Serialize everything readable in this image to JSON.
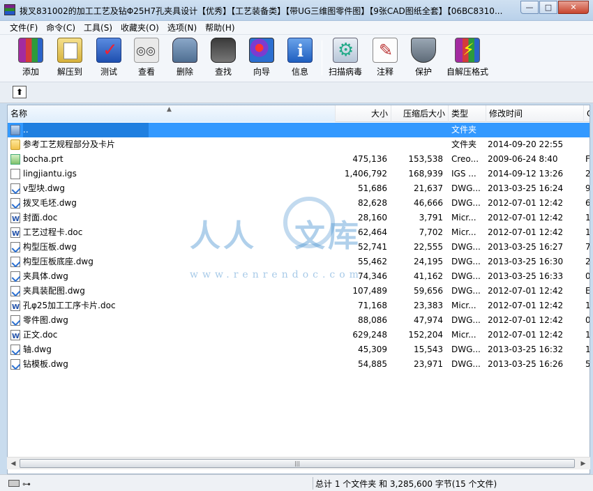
{
  "window": {
    "title": "拨叉831002的加工工艺及钻Φ25H7孔夹具设计【优秀】【工艺装备类】【带UG三维图零件图】【9张CAD图纸全套】【06BC8310...",
    "minimize": "—",
    "maximize": "□",
    "close": "✕"
  },
  "menu": [
    "文件(F)",
    "命令(C)",
    "工具(S)",
    "收藏夹(O)",
    "选项(N)",
    "帮助(H)"
  ],
  "toolbar": {
    "buttons": [
      {
        "label": "添加",
        "icon": "books-add-icon"
      },
      {
        "label": "解压到",
        "icon": "extract-to-icon"
      },
      {
        "label": "测试",
        "icon": "test-icon"
      },
      {
        "label": "查看",
        "icon": "view-icon"
      },
      {
        "label": "删除",
        "icon": "delete-icon"
      },
      {
        "label": "查找",
        "icon": "binoculars-icon"
      },
      {
        "label": "向导",
        "icon": "wizard-icon"
      },
      {
        "label": "信息",
        "icon": "info-icon"
      },
      {
        "label": "扫描病毒",
        "icon": "virus-scan-icon"
      },
      {
        "label": "注释",
        "icon": "comment-icon"
      },
      {
        "label": "保护",
        "icon": "shield-icon"
      },
      {
        "label": "自解压格式",
        "icon": "sfx-icon"
      }
    ]
  },
  "addressbar": {
    "up_label": "⬆"
  },
  "columns": {
    "name": "名称",
    "size": "大小",
    "packed": "压缩后大小",
    "type": "类型",
    "mtime": "修改时间",
    "crc": "C"
  },
  "files": [
    {
      "name": "..",
      "size": "",
      "packed": "",
      "type": "文件夹",
      "mtime": "",
      "crc": "",
      "kind": "parent"
    },
    {
      "name": "参考工艺规程部分及卡片",
      "size": "",
      "packed": "",
      "type": "文件夹",
      "mtime": "2014-09-20 22:55",
      "crc": "",
      "kind": "folder"
    },
    {
      "name": "bocha.prt",
      "size": "475,136",
      "packed": "153,538",
      "type": "Creo...",
      "mtime": "2009-06-24 8:40",
      "crc": "F",
      "kind": "prt"
    },
    {
      "name": "lingjiantu.igs",
      "size": "1,406,792",
      "packed": "168,939",
      "type": "IGS ...",
      "mtime": "2014-09-12 13:26",
      "crc": "2",
      "kind": "file"
    },
    {
      "name": "v型块.dwg",
      "size": "51,686",
      "packed": "21,637",
      "type": "DWG...",
      "mtime": "2013-03-25 16:24",
      "crc": "9",
      "kind": "dwg"
    },
    {
      "name": "拨叉毛坯.dwg",
      "size": "82,628",
      "packed": "46,666",
      "type": "DWG...",
      "mtime": "2012-07-01 12:42",
      "crc": "6",
      "kind": "dwg"
    },
    {
      "name": "封面.doc",
      "size": "28,160",
      "packed": "3,791",
      "type": "Micr...",
      "mtime": "2012-07-01 12:42",
      "crc": "1",
      "kind": "doc"
    },
    {
      "name": "工艺过程卡.doc",
      "size": "62,464",
      "packed": "7,702",
      "type": "Micr...",
      "mtime": "2012-07-01 12:42",
      "crc": "1",
      "kind": "doc"
    },
    {
      "name": "构型压板.dwg",
      "size": "52,741",
      "packed": "22,555",
      "type": "DWG...",
      "mtime": "2013-03-25 16:27",
      "crc": "7",
      "kind": "dwg"
    },
    {
      "name": "构型压板底座.dwg",
      "size": "55,462",
      "packed": "24,195",
      "type": "DWG...",
      "mtime": "2013-03-25 16:30",
      "crc": "2",
      "kind": "dwg"
    },
    {
      "name": "夹具体.dwg",
      "size": "74,346",
      "packed": "41,162",
      "type": "DWG...",
      "mtime": "2013-03-25 16:33",
      "crc": "0",
      "kind": "dwg"
    },
    {
      "name": "夹具装配图.dwg",
      "size": "107,489",
      "packed": "59,656",
      "type": "DWG...",
      "mtime": "2012-07-01 12:42",
      "crc": "E",
      "kind": "dwg"
    },
    {
      "name": "孔φ25加工工序卡片.doc",
      "size": "71,168",
      "packed": "23,383",
      "type": "Micr...",
      "mtime": "2012-07-01 12:42",
      "crc": "1",
      "kind": "doc"
    },
    {
      "name": "零件图.dwg",
      "size": "88,086",
      "packed": "47,974",
      "type": "DWG...",
      "mtime": "2012-07-01 12:42",
      "crc": "0",
      "kind": "dwg"
    },
    {
      "name": "正文.doc",
      "size": "629,248",
      "packed": "152,204",
      "type": "Micr...",
      "mtime": "2012-07-01 12:42",
      "crc": "1",
      "kind": "doc"
    },
    {
      "name": "轴.dwg",
      "size": "45,309",
      "packed": "15,543",
      "type": "DWG...",
      "mtime": "2013-03-25 16:32",
      "crc": "1",
      "kind": "dwg"
    },
    {
      "name": "钻模板.dwg",
      "size": "54,885",
      "packed": "23,971",
      "type": "DWG...",
      "mtime": "2013-03-25 16:26",
      "crc": "5",
      "kind": "dwg"
    }
  ],
  "watermark": {
    "text_left": "人人",
    "text_right": "文库",
    "url": "www.renrendoc.com"
  },
  "scrollbar": {
    "left": "◀",
    "right": "▶",
    "grip": "|||"
  },
  "status": {
    "key_icon": "⊶",
    "summary": "总计 1 个文件夹 和 3,285,600 字节(15 个文件)"
  }
}
